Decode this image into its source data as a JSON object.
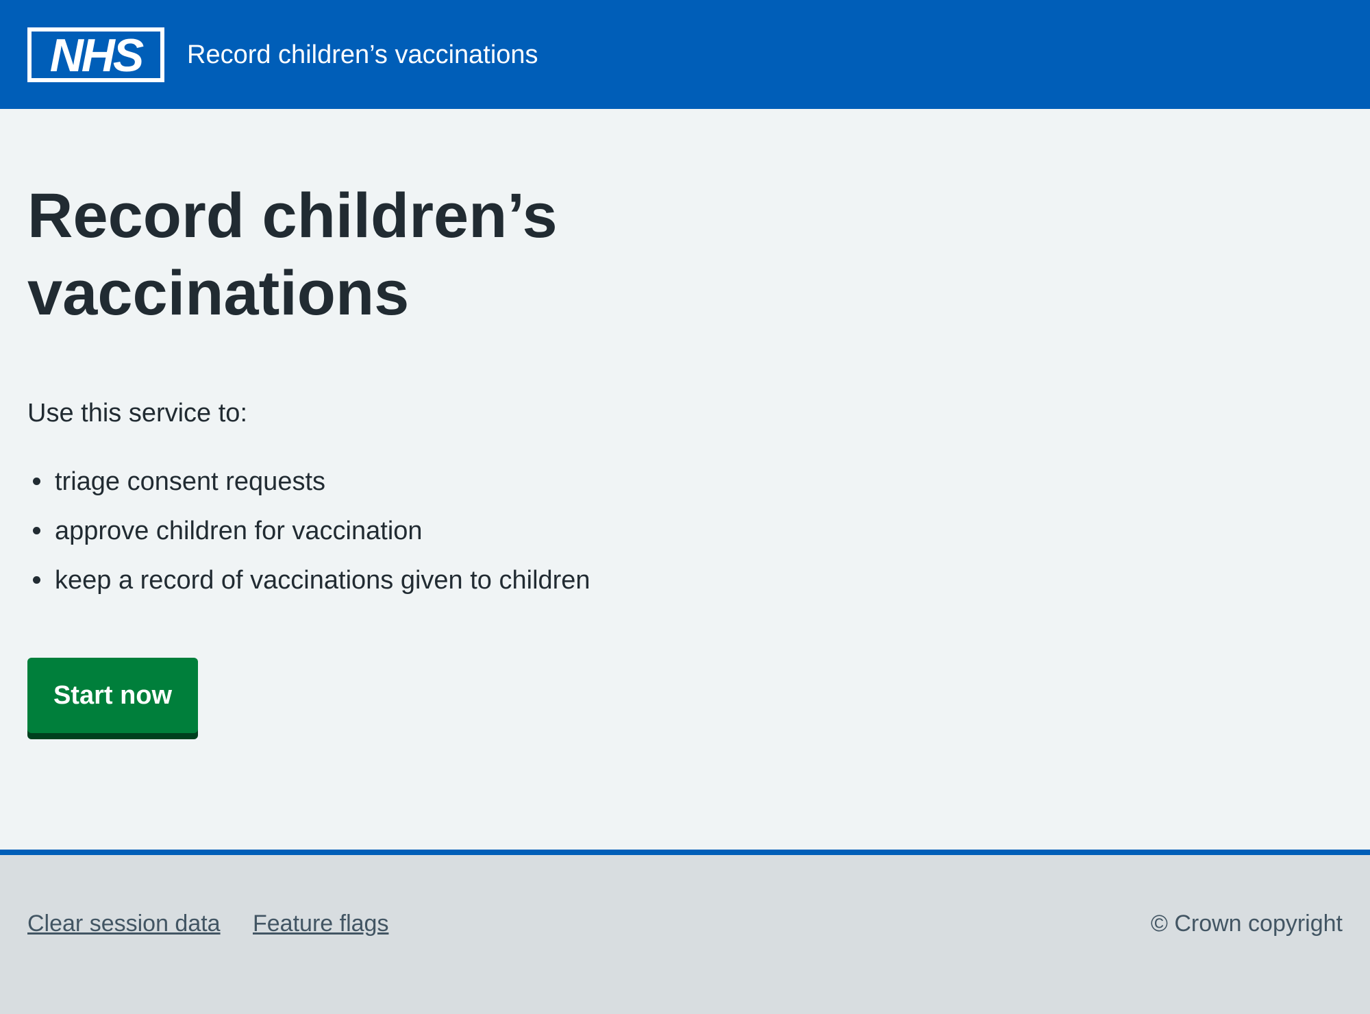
{
  "header": {
    "logo_text": "NHS",
    "service_name": "Record children’s vaccinations"
  },
  "main": {
    "title": "Record children’s vaccinations",
    "lead": "Use this service to:",
    "features": [
      "triage consent requests",
      "approve children for vaccination",
      "keep a record of vaccinations given to children"
    ],
    "start_button": "Start now"
  },
  "footer": {
    "links": [
      "Clear session data",
      "Feature flags"
    ],
    "copyright": "© Crown copyright"
  },
  "colors": {
    "header_blue": "#005eb8",
    "page_background": "#f0f4f5",
    "button_green": "#007f3b",
    "button_shadow": "#00401e",
    "footer_background": "#d8dde0",
    "text": "#212b32",
    "footer_text": "#425563"
  }
}
